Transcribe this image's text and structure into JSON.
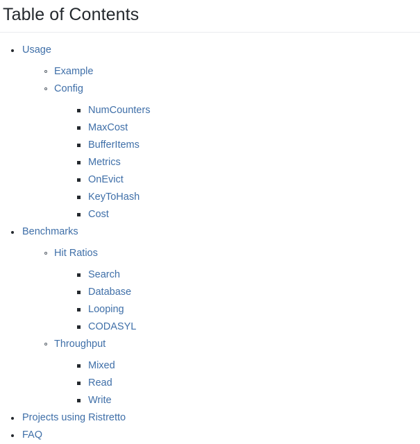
{
  "page": {
    "title": "Table of Contents",
    "link_color": "#3f6fa8",
    "heading_color": "#24292e",
    "divider_color": "#eaecef",
    "background_color": "#ffffff"
  },
  "toc": [
    {
      "label": "Usage",
      "marker": "disc",
      "children": [
        {
          "label": "Example",
          "marker": "circle",
          "children": []
        },
        {
          "label": "Config",
          "marker": "circle",
          "children": [
            {
              "label": "NumCounters",
              "marker": "square"
            },
            {
              "label": "MaxCost",
              "marker": "square"
            },
            {
              "label": "BufferItems",
              "marker": "square"
            },
            {
              "label": "Metrics",
              "marker": "square"
            },
            {
              "label": "OnEvict",
              "marker": "square"
            },
            {
              "label": "KeyToHash",
              "marker": "square"
            },
            {
              "label": "Cost",
              "marker": "square"
            }
          ]
        }
      ]
    },
    {
      "label": "Benchmarks",
      "marker": "disc",
      "children": [
        {
          "label": "Hit Ratios",
          "marker": "circle",
          "children": [
            {
              "label": "Search",
              "marker": "square"
            },
            {
              "label": "Database",
              "marker": "square"
            },
            {
              "label": "Looping",
              "marker": "square"
            },
            {
              "label": "CODASYL",
              "marker": "square"
            }
          ]
        },
        {
          "label": "Throughput",
          "marker": "circle",
          "children": [
            {
              "label": "Mixed",
              "marker": "square"
            },
            {
              "label": "Read",
              "marker": "square"
            },
            {
              "label": "Write",
              "marker": "square"
            }
          ]
        }
      ]
    },
    {
      "label": "Projects using Ristretto",
      "marker": "disc",
      "children": []
    },
    {
      "label": "FAQ",
      "marker": "disc",
      "children": []
    }
  ]
}
